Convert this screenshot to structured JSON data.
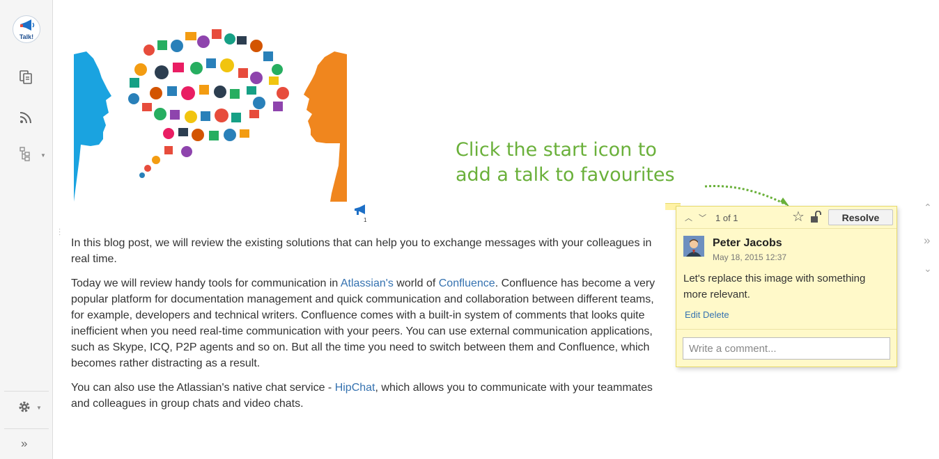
{
  "sidebar": {
    "logo_text": "Talk!",
    "icons": [
      "pages-icon",
      "rss-feed-icon",
      "page-tree-icon",
      "settings-gear-icon",
      "expand-sidebar-icon"
    ],
    "expand_label": "»"
  },
  "image": {
    "pin_count": "1"
  },
  "article": {
    "p1": "In this blog post, we will review the existing solutions that can help you to exchange messages with your colleagues in real time.",
    "p2_before_link1": "Today we will review handy tools for communication in ",
    "p2_link1": "Atlassian's",
    "p2_between_links": " world of ",
    "p2_link2": "Confluence",
    "p2_after_link2": ". Confluence has become a very popular platform for documentation management and quick communication and collaboration between different teams, for example, developers and technical writers. Confluence comes with a built-in system of comments that looks quite inefficient when you need real-time communication with your peers. You can use external communication applications, such as Skype, ICQ, P2P agents and so on. But all the time you need to switch between them and Confluence, which becomes rather distracting as a result.",
    "p3_before_link": "You can also use the Atlassian's native chat service - ",
    "p3_link": "HipChat",
    "p3_after_link": ", which allows you to communicate with your teammates and colleagues in group chats and video chats."
  },
  "callout": {
    "line1": "Click the start icon to",
    "line2": "add a talk to favourites",
    "color": "#6ab03a"
  },
  "comment": {
    "count": "1 of 1",
    "resolve_label": "Resolve",
    "author": "Peter Jacobs",
    "date": "May 18, 2015 12:37",
    "body": "Let's replace this image with something more relevant.",
    "edit_label": "Edit",
    "delete_label": "Delete",
    "input_placeholder": "Write a comment...",
    "background_color": "#fff9c9"
  },
  "right_nav": {
    "up": "⌃",
    "expand": "»",
    "down": "⌄"
  },
  "colors": {
    "link": "#3572b0",
    "text": "#333333",
    "silhouette_left": "#1aa3e0",
    "silhouette_right": "#f0861e"
  }
}
